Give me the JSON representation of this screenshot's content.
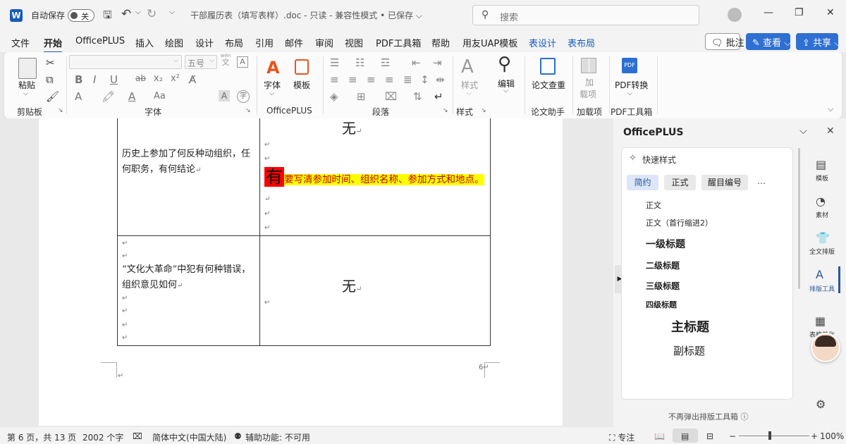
{
  "titlebar": {
    "autosave_label": "自动保存",
    "autosave_state": "关",
    "doc_title": "干部履历表（填写表样）.doc - 只读 - 兼容性模式 • 已保存 ⌵",
    "search_placeholder": "搜索"
  },
  "menu": {
    "items": [
      "文件",
      "开始",
      "OfficePLUS",
      "插入",
      "绘图",
      "设计",
      "布局",
      "引用",
      "邮件",
      "审阅",
      "视图",
      "PDF工具箱",
      "帮助",
      "用友UAP模板",
      "表设计",
      "表布局"
    ],
    "comment_btn": "批注",
    "view_btn": "查看",
    "share_btn": "共享"
  },
  "ribbon": {
    "clipboard": {
      "paste": "粘贴",
      "label": "剪贴板"
    },
    "font": {
      "font_name": "",
      "font_size": "五号",
      "label": "字体",
      "wen": "wén",
      "wen_char": "文",
      "aa": "Aa"
    },
    "officeplus": {
      "font_btn": "字体",
      "template_btn": "模板",
      "label": "OfficePLUS"
    },
    "paragraph": {
      "label": "段落"
    },
    "styles": {
      "style_btn": "样式",
      "label": "样式"
    },
    "edit": {
      "edit_btn": "编辑"
    },
    "paper": {
      "check_btn": "论文查重",
      "label": "论文助手"
    },
    "addins": {
      "btn": "加载项",
      "btn_line1": "加",
      "btn_line2": "载项",
      "label": "加载项"
    },
    "pdf": {
      "convert_btn": "PDF转换",
      "label": "PDF工具箱"
    }
  },
  "document": {
    "row1_cell1_text": "历史上参加了何反种动组织，任何职务，有何结论",
    "row1_cell2_top": "无",
    "row1_highlight_big": "有",
    "row1_highlight_text": "要写清参加时间、组织名称、参加方式和地点。",
    "row2_cell1_text": "“文化大革命”中犯有何种错误，组织意见如何",
    "row2_cell2_text": "无",
    "page_number": "6",
    "para_mark": "↵"
  },
  "pane": {
    "title": "OfficePLUS",
    "quick_style": "快速样式",
    "chips": [
      "简约",
      "正式",
      "醒目编号",
      "…"
    ],
    "styles": [
      "正文",
      "正文（首行缩进2）",
      "一级标题",
      "二级标题",
      "三级标题",
      "四级标题",
      "主标题",
      "副标题"
    ],
    "footer": "不再弹出排版工具箱 ⓘ",
    "rail": [
      "模板",
      "素材",
      "全文排版",
      "排版工具",
      "表格美化"
    ]
  },
  "status": {
    "page": "第 6 页，共 13 页",
    "words": "2002 个字",
    "lang": "简体中文(中国大陆)",
    "access": "辅助功能: 不可用",
    "focus": "专注",
    "zoom": "100%"
  },
  "colors": {
    "accent": "#2b579a",
    "highlight_yellow": "#ffff00",
    "highlight_red": "#ff0000",
    "highlight_text_red": "#c00000"
  }
}
